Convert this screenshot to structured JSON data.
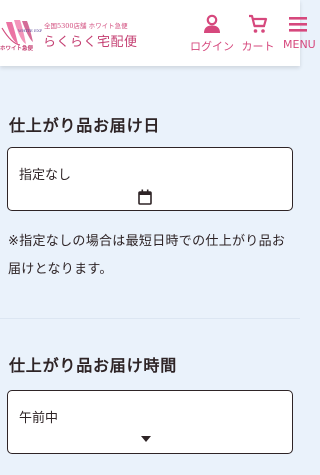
{
  "header": {
    "logo_tagline": "全国5300店舗 ホワイト急便",
    "logo_title": "らくらく宅配便",
    "logo_art_text": "WHITE EXPRESS ホワイト急便",
    "nav": {
      "login": "ログイン",
      "cart": "カート",
      "menu": "MENU"
    }
  },
  "delivery_date": {
    "title": "仕上がり品お届け日",
    "value": "指定なし",
    "icon": "calendar-icon",
    "note": "※指定なしの場合は最短日時での仕上がり品お届けとなります。"
  },
  "delivery_time": {
    "title": "仕上がり品お届け時間",
    "value": "午前中",
    "icon": "chevron-down-icon"
  },
  "colors": {
    "brand_pink": "#d6487d",
    "background": "#eaf2fb",
    "text": "#2e2426"
  }
}
